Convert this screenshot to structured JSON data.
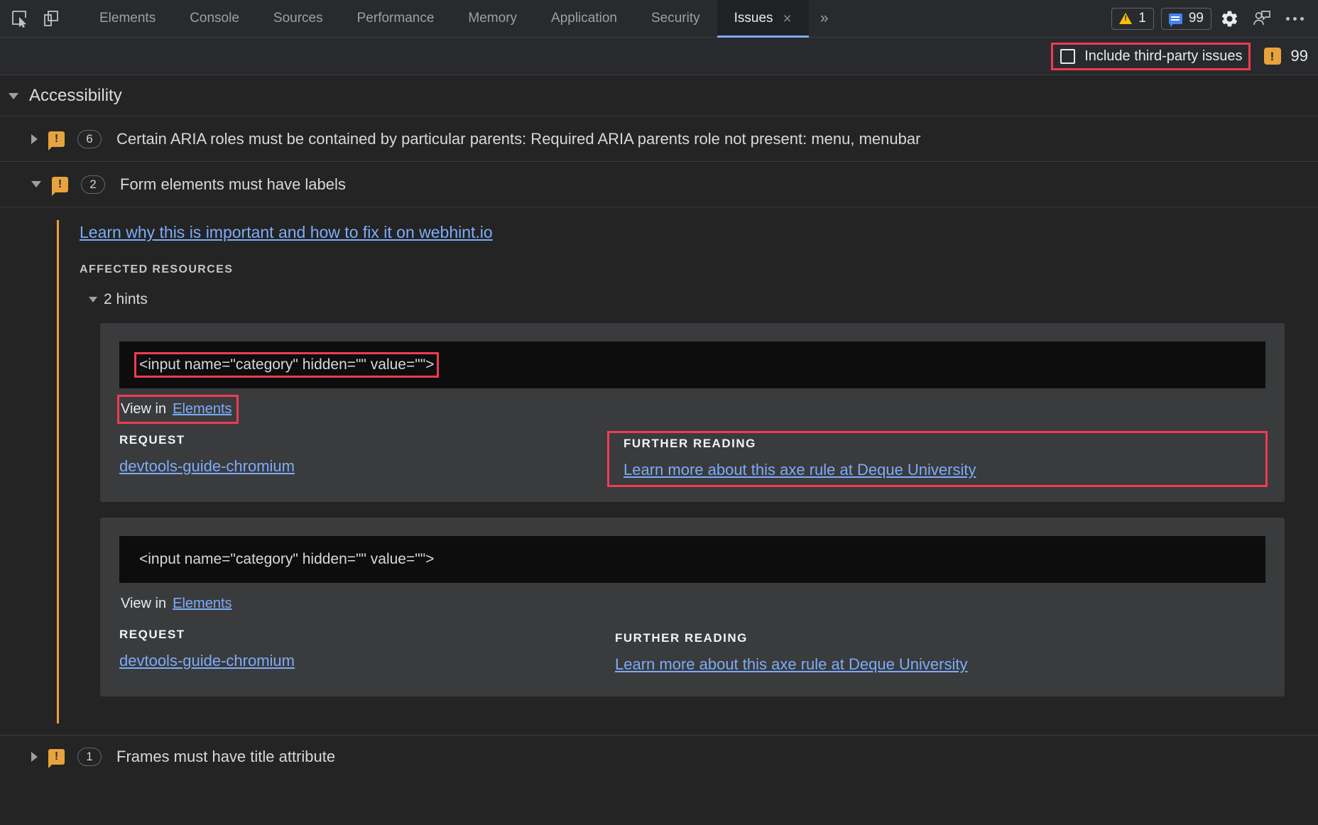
{
  "toolbar": {
    "inspect_icon": "inspect-cursor-icon",
    "device_icon": "device-toolbar-icon",
    "tabs": [
      {
        "label": "Elements",
        "active": false
      },
      {
        "label": "Console",
        "active": false
      },
      {
        "label": "Sources",
        "active": false
      },
      {
        "label": "Performance",
        "active": false
      },
      {
        "label": "Memory",
        "active": false
      },
      {
        "label": "Application",
        "active": false
      },
      {
        "label": "Security",
        "active": false
      },
      {
        "label": "Issues",
        "active": true
      }
    ],
    "close_glyph": "×",
    "more_tabs_glyph": "»",
    "warning_count": "1",
    "message_count": "99",
    "settings_icon": "gear-icon",
    "feedback_icon": "feedback-person-icon",
    "more_options_icon": "three-dots-icon"
  },
  "filterbar": {
    "third_party_label": "Include third-party issues",
    "third_party_checked": false,
    "issue_count": "99"
  },
  "content": {
    "category": {
      "title": "Accessibility",
      "expanded": true
    },
    "issues": [
      {
        "title": "Certain ARIA roles must be contained by particular parents: Required ARIA parents role not present: menu, menubar",
        "count": "6",
        "expanded": false
      },
      {
        "title": "Form elements must have labels",
        "count": "2",
        "expanded": true,
        "learn_link": "Learn why this is important and how to fix it on webhint.io",
        "affected_resources_label": "AFFECTED RESOURCES",
        "hints_toggle": "2 hints",
        "hints": [
          {
            "code": "<input name=\"category\" hidden=\"\" value=\"\">",
            "view_in_label": "View in",
            "view_in_link": "Elements",
            "request_label": "REQUEST",
            "request_link": "devtools-guide-chromium",
            "further_reading_label": "FURTHER READING",
            "further_reading_link": "Learn more about this axe rule at Deque University",
            "annotated": true
          },
          {
            "code": "<input name=\"category\" hidden=\"\" value=\"\">",
            "view_in_label": "View in",
            "view_in_link": "Elements",
            "request_label": "REQUEST",
            "request_link": "devtools-guide-chromium",
            "further_reading_label": "FURTHER READING",
            "further_reading_link": "Learn more about this axe rule at Deque University",
            "annotated": false
          }
        ]
      },
      {
        "title": "Frames must have title attribute",
        "count": "1",
        "expanded": false
      }
    ]
  },
  "colors": {
    "accent_blue": "#7cacf8",
    "warning_orange": "#e8a33d",
    "annotation_red": "#f03b52",
    "background": "#242424",
    "panel": "#292a2d"
  }
}
